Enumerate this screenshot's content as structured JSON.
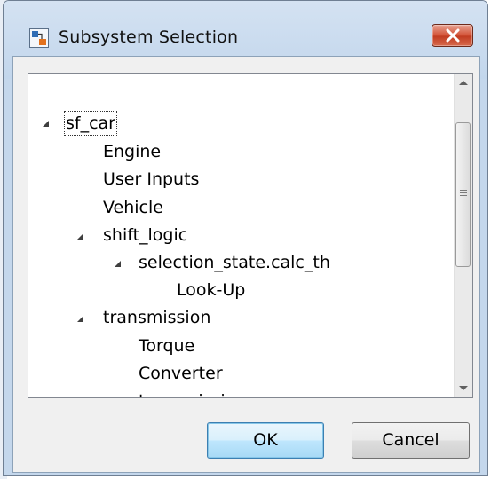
{
  "window": {
    "title": "Subsystem Selection",
    "icon": "simulink-model-icon",
    "close_icon": "close-x-icon"
  },
  "tree": {
    "items": [
      {
        "label": "sf_car",
        "expanded": true,
        "selected": true
      },
      {
        "label": "Engine"
      },
      {
        "label": "User Inputs"
      },
      {
        "label": "Vehicle"
      },
      {
        "label": "shift_logic",
        "expanded": true
      },
      {
        "label": "selection_state.calc_th",
        "expanded": true
      },
      {
        "label": "Look-Up"
      },
      {
        "label": "transmission",
        "expanded": true
      },
      {
        "label": "Torque"
      },
      {
        "label": "Converter"
      },
      {
        "label": "transmission"
      }
    ]
  },
  "buttons": {
    "ok_label": "OK",
    "cancel_label": "Cancel"
  },
  "colors": {
    "title_bar": "#c4d7ec",
    "close_button": "#c9472b",
    "default_button": "#bee6fd"
  }
}
